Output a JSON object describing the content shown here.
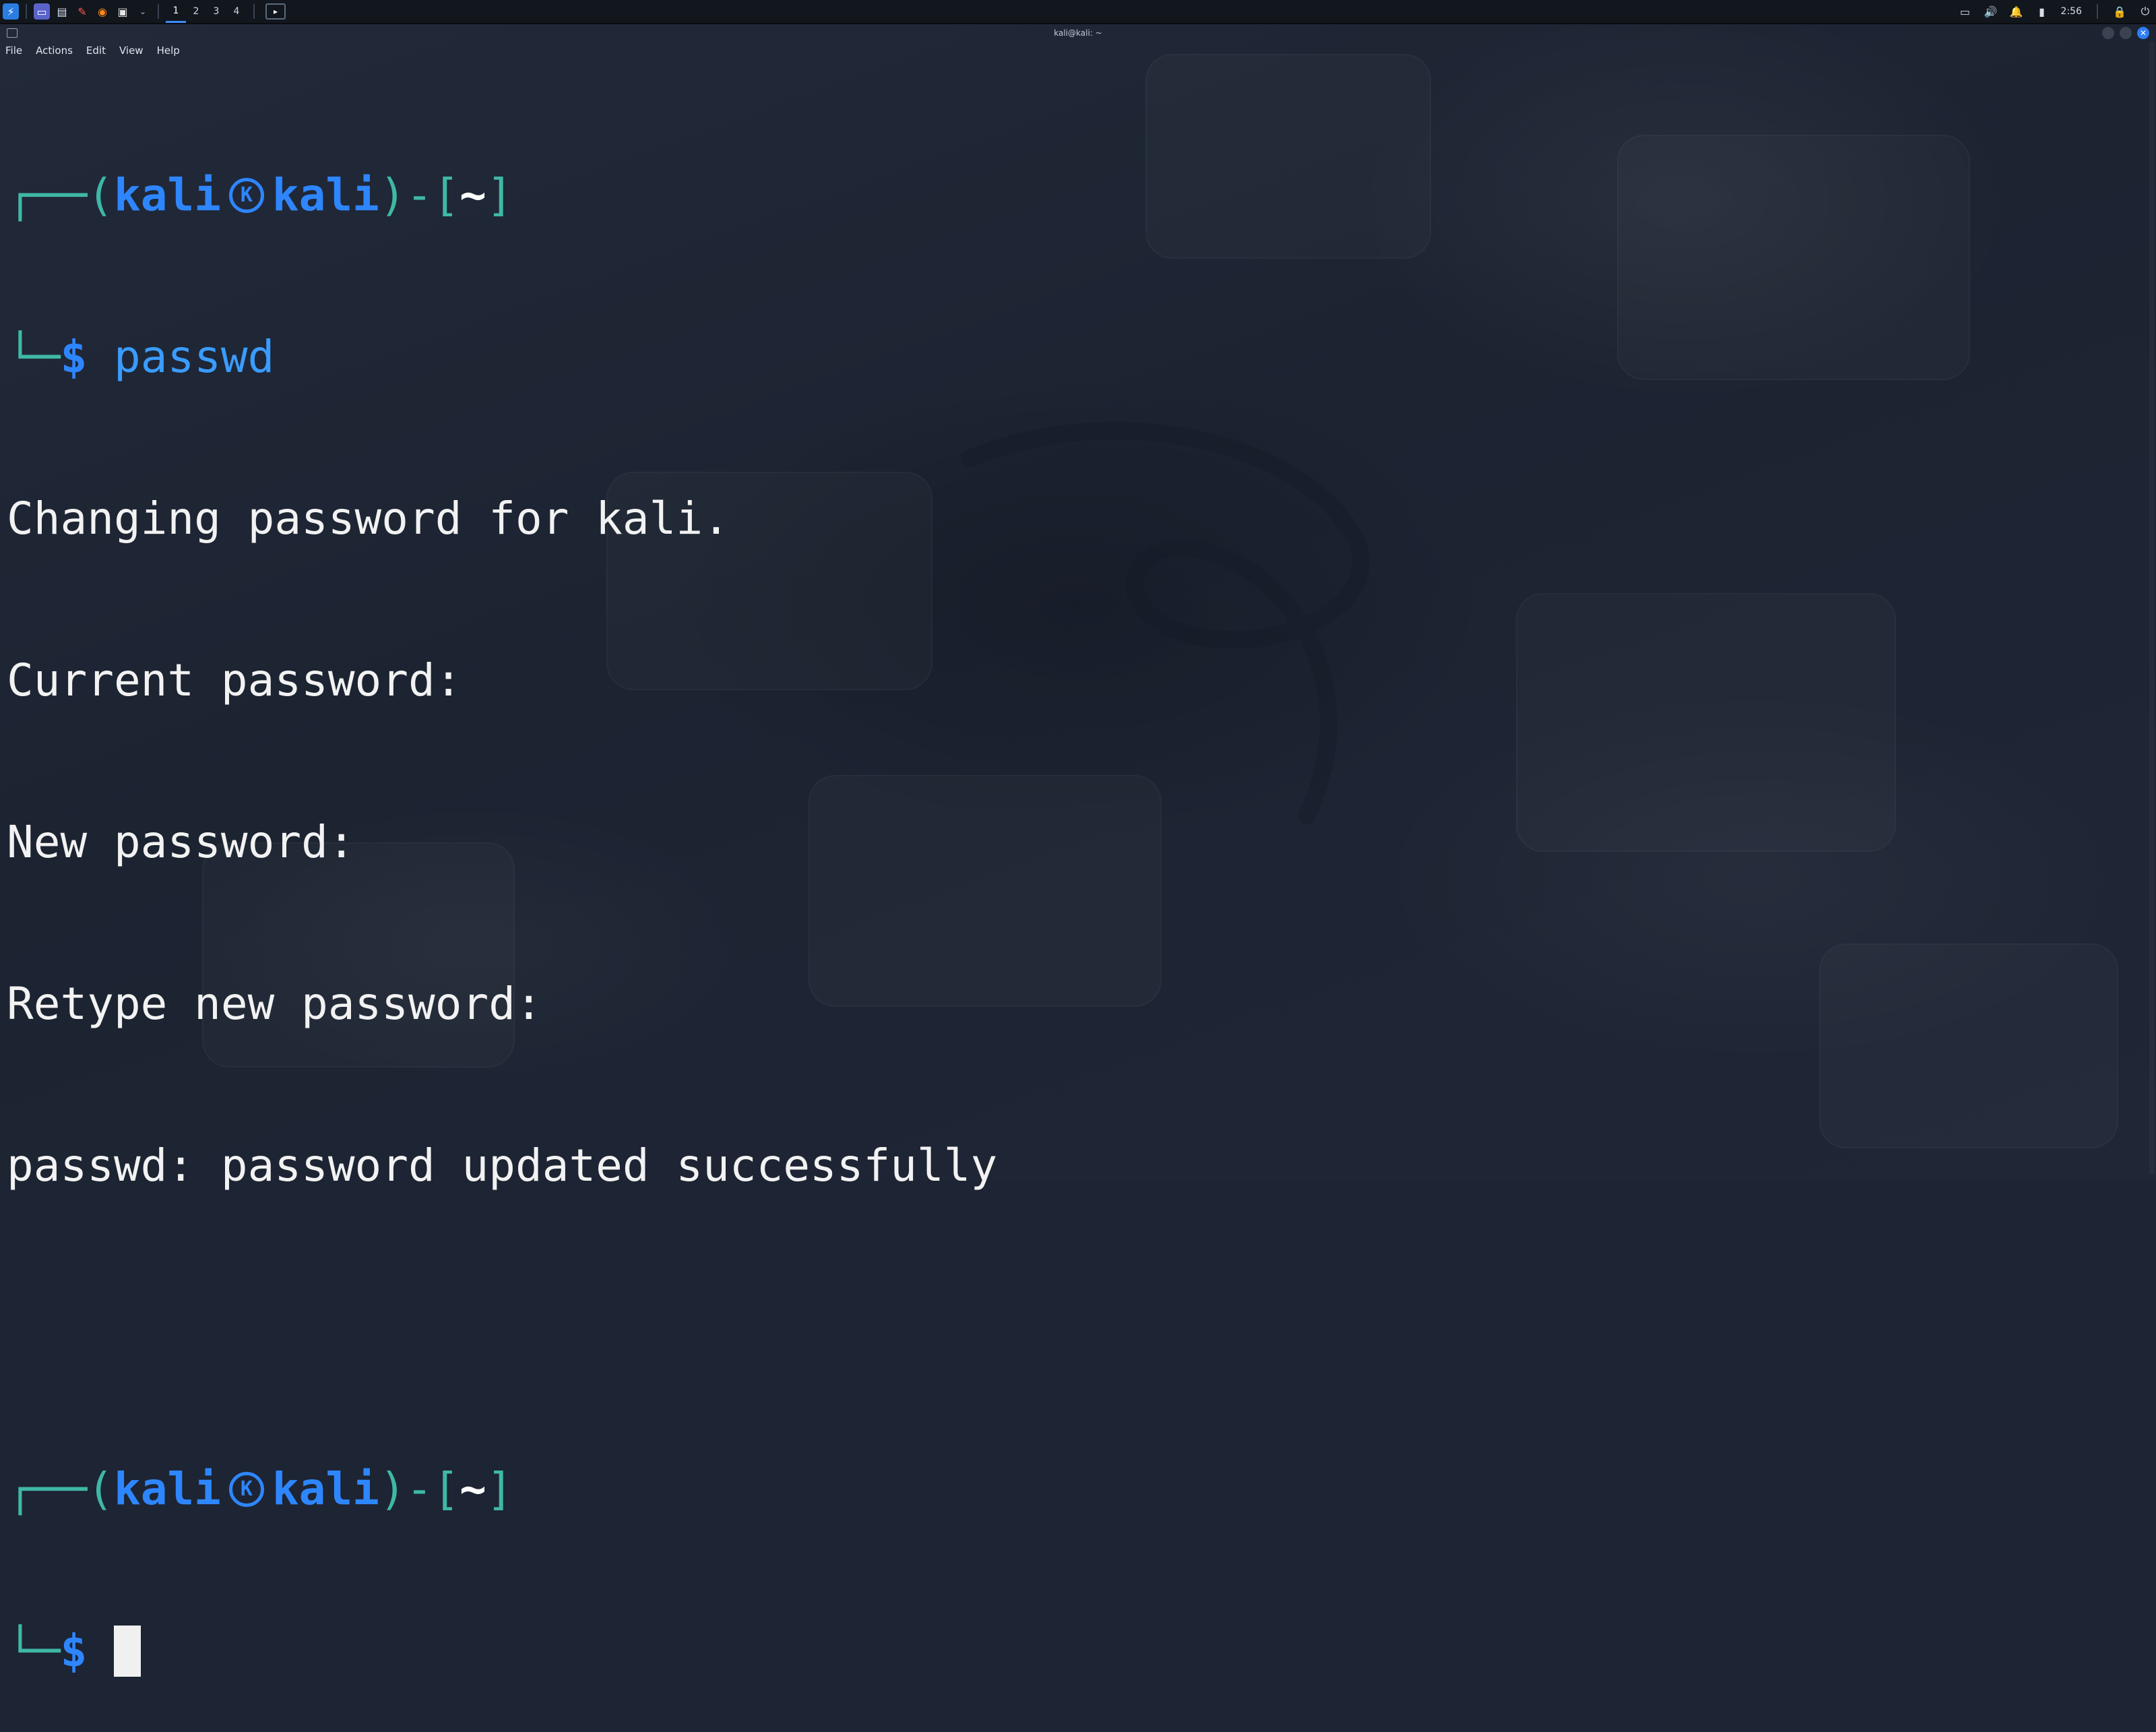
{
  "panel": {
    "workspaces": [
      "1",
      "2",
      "3",
      "4"
    ],
    "active_workspace": "1",
    "clock": "2:56",
    "icons": [
      "kali-menu-icon",
      "desktop-icon",
      "file-manager-icon",
      "text-editor-icon",
      "firefox-icon",
      "terminal-icon"
    ]
  },
  "window": {
    "title": "kali@kali: ~",
    "menu": [
      "File",
      "Actions",
      "Edit",
      "View",
      "Help"
    ]
  },
  "terminal": {
    "user": "kali",
    "host": "kali",
    "dir": "~",
    "command": "passwd",
    "output": [
      "Changing password for kali.",
      "Current password:",
      "New password:",
      "Retype new password:",
      "passwd: password updated successfully"
    ],
    "prompt_symbol": "$"
  },
  "colors": {
    "prompt_teal": "#3fb8a6",
    "prompt_blue": "#2e86ff",
    "background": "#1d2433"
  }
}
